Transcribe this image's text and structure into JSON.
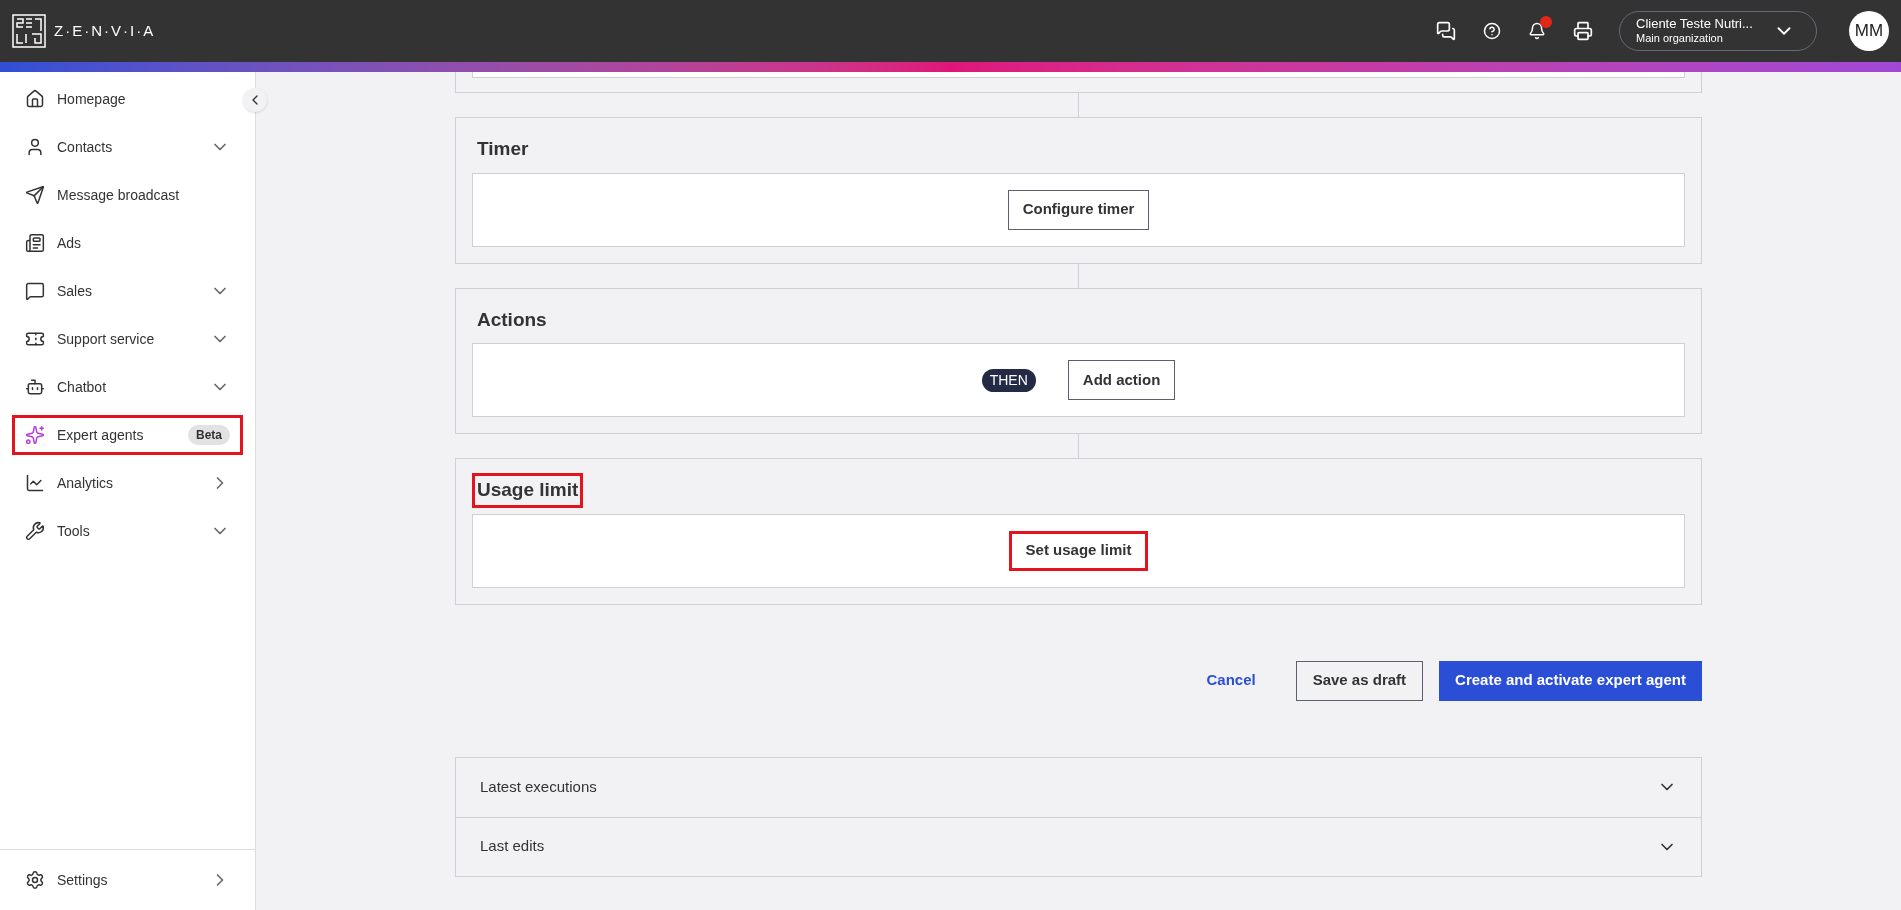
{
  "header": {
    "logo_text": "Z·E·N·V·I·A",
    "organization": {
      "name": "Cliente Teste Nutri...",
      "subtitle": "Main organization"
    },
    "notification_dot": true,
    "avatar": "MM"
  },
  "sidebar": {
    "items": [
      {
        "label": "Homepage",
        "kind": "plain",
        "highlighted": false
      },
      {
        "label": "Contacts",
        "kind": "expand",
        "highlighted": false
      },
      {
        "label": "Message broadcast",
        "kind": "plain",
        "highlighted": false
      },
      {
        "label": "Ads",
        "kind": "plain",
        "highlighted": false
      },
      {
        "label": "Sales",
        "kind": "expand",
        "highlighted": false
      },
      {
        "label": "Support service",
        "kind": "expand",
        "highlighted": false
      },
      {
        "label": "Chatbot",
        "kind": "expand",
        "highlighted": false
      },
      {
        "label": "Expert agents",
        "kind": "plain",
        "badge": "Beta",
        "highlighted": true
      },
      {
        "label": "Analytics",
        "kind": "link",
        "highlighted": false
      },
      {
        "label": "Tools",
        "kind": "expand",
        "highlighted": false
      }
    ],
    "footer": {
      "label": "Settings",
      "kind": "link",
      "highlighted": false
    }
  },
  "sections": [
    {
      "title": "Timer",
      "title_highlighted": false,
      "button": "Configure timer",
      "button_highlighted": false
    },
    {
      "title": "Actions",
      "title_highlighted": false,
      "tag": "THEN",
      "button": "Add action",
      "button_highlighted": false
    },
    {
      "title": "Usage limit",
      "title_highlighted": true,
      "button": "Set usage limit",
      "button_highlighted": true
    }
  ],
  "footer_actions": {
    "cancel": "Cancel",
    "draft": "Save as draft",
    "primary": "Create and activate expert agent"
  },
  "accordions": [
    {
      "label": "Latest executions",
      "expanded": false
    },
    {
      "label": "Last edits",
      "expanded": false
    }
  ]
}
